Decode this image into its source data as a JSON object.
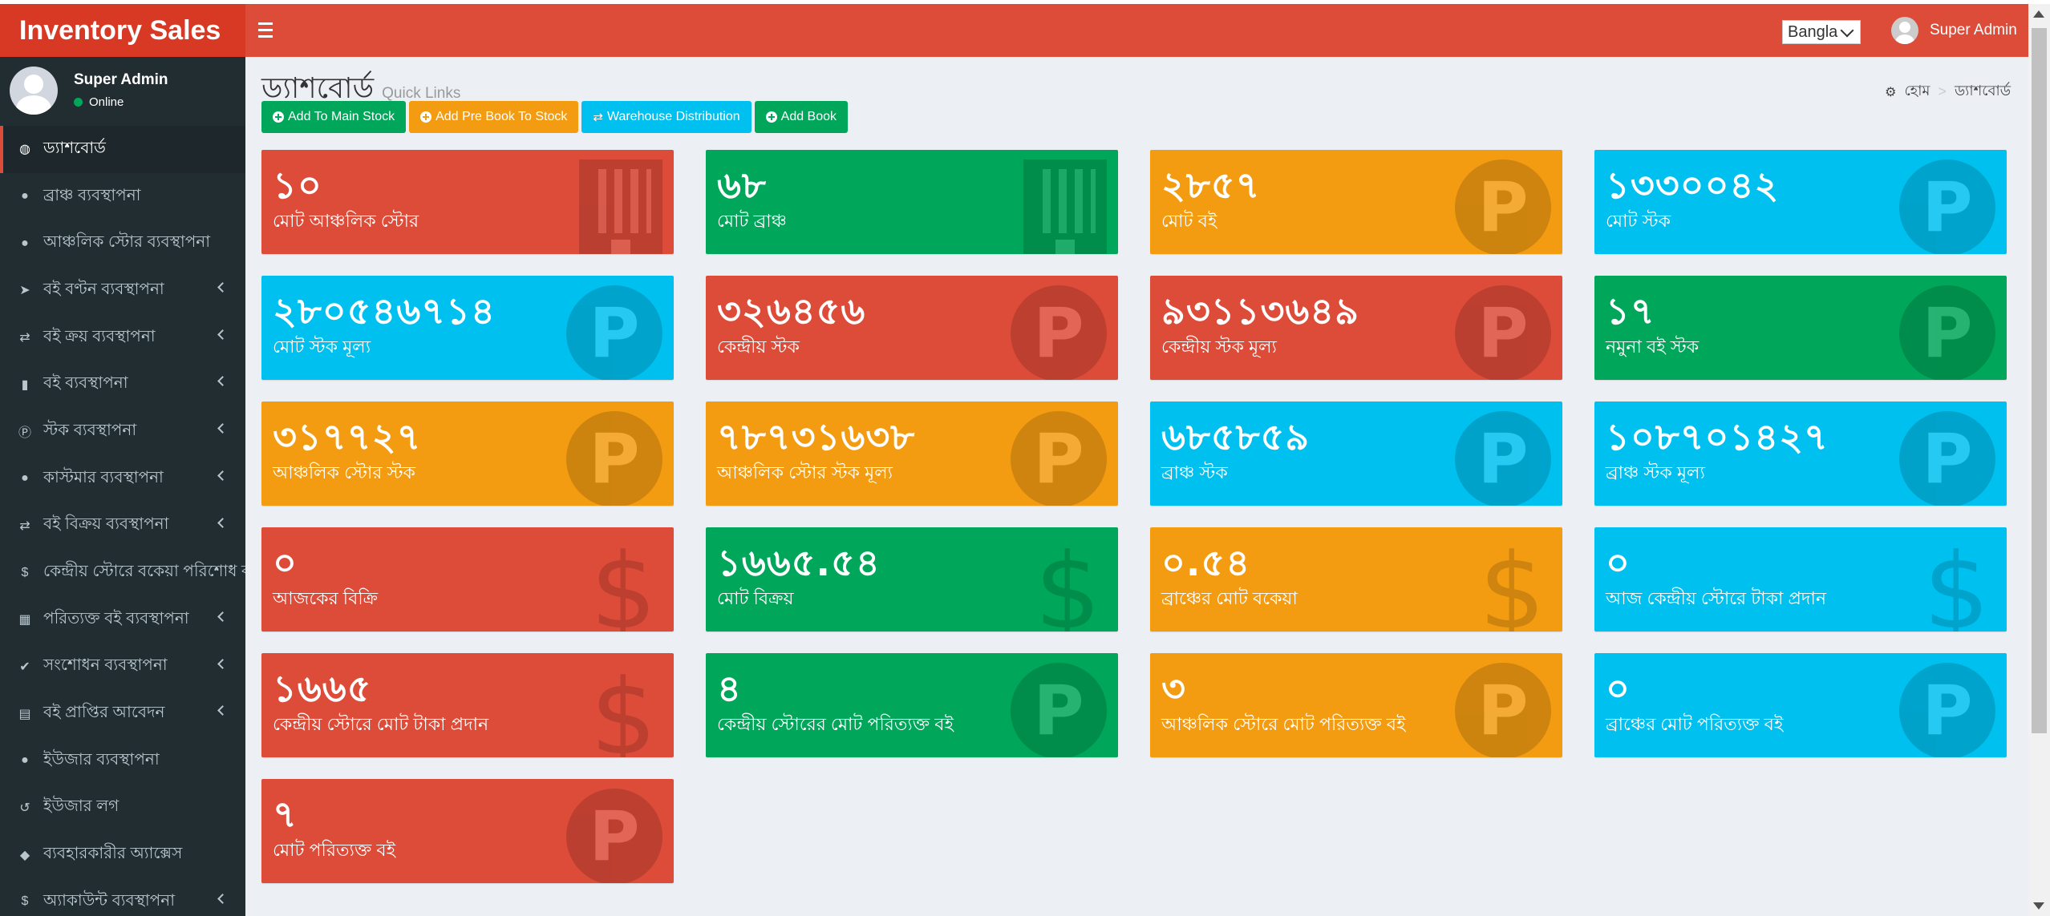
{
  "app": {
    "logo_text": "Inventory Sales",
    "language_selected": "Bangla",
    "user_name": "Super Admin"
  },
  "sidebar": {
    "user_name": "Super Admin",
    "status": "Online",
    "items": [
      {
        "label": "ড্যাশবোর্ড",
        "icon": "dashboard-icon",
        "active": true
      },
      {
        "label": "ব্রাঞ্চ ব্যবস্থাপনা",
        "icon": "user-circle-icon"
      },
      {
        "label": "আঞ্চলিক স্টোর ব্যবস্থাপনা",
        "icon": "user-circle-icon"
      },
      {
        "label": "বই বণ্টন ব্যবস্থাপনা",
        "icon": "paper-plane-icon",
        "submenu": true
      },
      {
        "label": "বই ক্রয় ব্যবস্থাপনা",
        "icon": "exchange-icon",
        "submenu": true
      },
      {
        "label": "বই ব্যবস্থাপনা",
        "icon": "book-icon",
        "submenu": true
      },
      {
        "label": "স্টক ব্যবস্থাপনা",
        "icon": "product-hunt-icon",
        "submenu": true
      },
      {
        "label": "কাস্টমার ব্যবস্থাপনা",
        "icon": "user-circle-icon",
        "submenu": true
      },
      {
        "label": "বই বিক্রয় ব্যবস্থাপনা",
        "icon": "exchange-icon",
        "submenu": true
      },
      {
        "label": "কেন্দ্রীয় স্টোরে বকেয়া পরিশোধ ব্",
        "icon": "dollar-icon"
      },
      {
        "label": "পরিত্যক্ত বই ব্যবস্থাপনা",
        "icon": "grid-icon",
        "submenu": true
      },
      {
        "label": "সংশোধন ব্যবস্থাপনা",
        "icon": "check-circle-icon",
        "submenu": true
      },
      {
        "label": "বই প্রাপ্তির আবেদন",
        "icon": "file-icon",
        "submenu": true
      },
      {
        "label": "ইউজার ব্যবস্থাপনা",
        "icon": "user-circle-icon"
      },
      {
        "label": "ইউজার লগ",
        "icon": "history-icon"
      },
      {
        "label": "ব্যবহারকারীর অ্যাক্সেস",
        "icon": "shield-icon"
      },
      {
        "label": "অ্যাকাউন্ট ব্যবস্থাপনা",
        "icon": "dollar-icon",
        "submenu": true
      }
    ]
  },
  "page": {
    "title": "ড্যাশবোর্ড",
    "subtitle": "Quick Links",
    "breadcrumb_home": "হোম",
    "breadcrumb_sep": ">",
    "breadcrumb_current": "ড্যাশবোর্ড"
  },
  "quick_links": [
    {
      "label": "Add To Main Stock",
      "color": "#00a65a",
      "icon": "plus-circle-icon"
    },
    {
      "label": "Add Pre Book To Stock",
      "color": "#f39c12",
      "icon": "plus-circle-icon"
    },
    {
      "label": "Warehouse Distribution",
      "color": "#00c0ef",
      "icon": "exchange-icon"
    },
    {
      "label": "Add Book",
      "color": "#00a65a",
      "icon": "plus-circle-icon"
    }
  ],
  "stats": [
    {
      "value": "১০",
      "label": "মোট আঞ্চলিক স্টোর",
      "color": "red",
      "icon": "building-icon"
    },
    {
      "value": "৬৮",
      "label": "মোট ব্রাঞ্চ",
      "color": "green",
      "icon": "building-icon"
    },
    {
      "value": "২৮৫৭",
      "label": "মোট বই",
      "color": "orange",
      "icon": "product-hunt-icon"
    },
    {
      "value": "১৩৩০০৪২",
      "label": "মোট স্টক",
      "color": "aqua",
      "icon": "product-hunt-icon"
    },
    {
      "value": "২৮০৫৪৬৭১৪",
      "label": "মোট স্টক মূল্য",
      "color": "aqua",
      "icon": "product-hunt-icon"
    },
    {
      "value": "৩২৬৪৫৬",
      "label": "কেন্দ্রীয় স্টক",
      "color": "red",
      "icon": "product-hunt-icon"
    },
    {
      "value": "৯৩১১৩৬৪৯",
      "label": "কেন্দ্রীয় স্টক মূল্য",
      "color": "red",
      "icon": "product-hunt-icon"
    },
    {
      "value": "১৭",
      "label": "নমুনা বই স্টক",
      "color": "green",
      "icon": "product-hunt-icon"
    },
    {
      "value": "৩১৭৭২৭",
      "label": "আঞ্চলিক স্টোর স্টক",
      "color": "orange",
      "icon": "product-hunt-icon"
    },
    {
      "value": "৭৮৭৩১৬৩৮",
      "label": "আঞ্চলিক স্টোর স্টক মূল্য",
      "color": "orange",
      "icon": "product-hunt-icon"
    },
    {
      "value": "৬৮৫৮৫৯",
      "label": "ব্রাঞ্চ স্টক",
      "color": "aqua",
      "icon": "product-hunt-icon"
    },
    {
      "value": "১০৮৭০১৪২৭",
      "label": "ব্রাঞ্চ স্টক মূল্য",
      "color": "aqua",
      "icon": "product-hunt-icon"
    },
    {
      "value": "০",
      "label": "আজকের বিক্রি",
      "color": "red",
      "icon": "dollar-icon"
    },
    {
      "value": "১৬৬৫.৫৪",
      "label": "মোট বিক্রয়",
      "color": "green",
      "icon": "dollar-icon"
    },
    {
      "value": "০.৫৪",
      "label": "ব্রাঞ্চের মোট বকেয়া",
      "color": "orange",
      "icon": "dollar-icon"
    },
    {
      "value": "০",
      "label": "আজ কেন্দ্রীয় স্টোরে টাকা প্রদান",
      "color": "aqua",
      "icon": "dollar-icon"
    },
    {
      "value": "১৬৬৫",
      "label": "কেন্দ্রীয় স্টোরে মোট টাকা প্রদান",
      "color": "red",
      "icon": "dollar-icon"
    },
    {
      "value": "৪",
      "label": "কেন্দ্রীয় স্টোরের মোট পরিত্যক্ত বই",
      "color": "green",
      "icon": "product-hunt-icon"
    },
    {
      "value": "৩",
      "label": "আঞ্চলিক স্টোরে মোট পরিত্যক্ত বই",
      "color": "orange",
      "icon": "product-hunt-icon"
    },
    {
      "value": "০",
      "label": "ব্রাঞ্চের মোট পরিত্যক্ত বই",
      "color": "aqua",
      "icon": "product-hunt-icon"
    },
    {
      "value": "৭",
      "label": "মোট পরিত্যক্ত বই",
      "color": "red",
      "icon": "product-hunt-icon"
    }
  ]
}
